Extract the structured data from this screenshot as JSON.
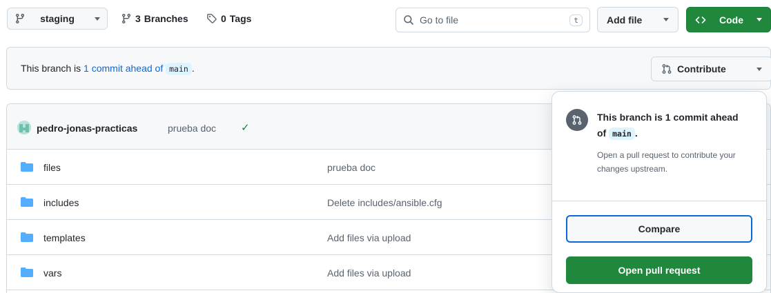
{
  "toolbar": {
    "branch": {
      "icon": "git-branch-icon",
      "label": "staging"
    },
    "branches": {
      "icon": "git-branch-icon",
      "count": "3",
      "label": "Branches"
    },
    "tags": {
      "icon": "tag-icon",
      "count": "0",
      "label": "Tags"
    },
    "goto_file": {
      "icon": "search-icon",
      "placeholder": "Go to file",
      "shortcut": "t"
    },
    "add_file": {
      "label": "Add file"
    },
    "code": {
      "icon": "code-icon",
      "label": "Code"
    }
  },
  "branch_info": {
    "prefix": "This branch is",
    "link": "1 commit ahead of",
    "base": "main",
    "suffix": ".",
    "contribute": {
      "icon": "git-pull-request-icon",
      "label": "Contribute"
    }
  },
  "latest_commit": {
    "author": "pedro-jonas-practicas",
    "message": "prueba doc",
    "status": "check-icon"
  },
  "files": [
    {
      "name": "files",
      "message": "prueba doc"
    },
    {
      "name": "includes",
      "message": "Delete includes/ansible.cfg"
    },
    {
      "name": "templates",
      "message": "Add files via upload"
    },
    {
      "name": "vars",
      "message": "Add files via upload"
    }
  ],
  "popover": {
    "icon": "git-pull-request-icon",
    "title_prefix": "This branch is 1 commit ahead of",
    "base": "main",
    "title_suffix": ".",
    "description": "Open a pull request to contribute your changes upstream.",
    "compare_label": "Compare",
    "open_pr_label": "Open pull request"
  },
  "colors": {
    "primary_green": "#1f883d",
    "link_blue": "#0969da",
    "folder_blue": "#54aeff",
    "check_green": "#1a7f37"
  }
}
